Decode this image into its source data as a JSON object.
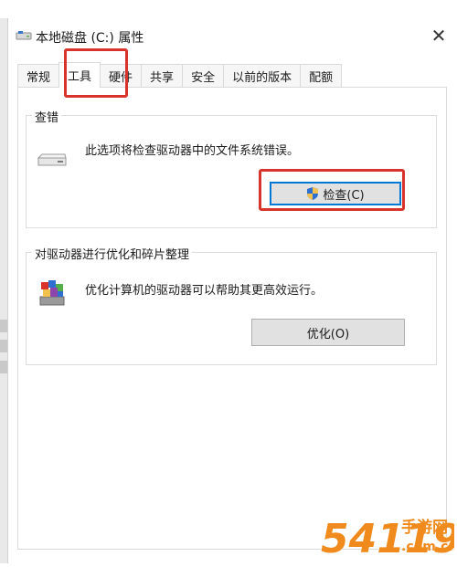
{
  "window": {
    "title": "本地磁盘 (C:) 属性"
  },
  "tabs": [
    {
      "label": "常规"
    },
    {
      "label": "工具",
      "active": true
    },
    {
      "label": "硬件"
    },
    {
      "label": "共享"
    },
    {
      "label": "安全"
    },
    {
      "label": "以前的版本"
    },
    {
      "label": "配额"
    }
  ],
  "error_check": {
    "title": "查错",
    "description": "此选项将检查驱动器中的文件系统错误。",
    "button_label": "检查(C)"
  },
  "optimize": {
    "title": "对驱动器进行优化和碎片整理",
    "description": "优化计算机的驱动器可以帮助其更高效运行。",
    "button_label": "优化(O)"
  },
  "watermark": {
    "brand_number": "54119",
    "brand_text": "手游网",
    "domain": ".com.cn"
  },
  "colors": {
    "highlight": "#d9342b",
    "accent": "#0078d7",
    "watermark_orange": "#f08a1c"
  }
}
